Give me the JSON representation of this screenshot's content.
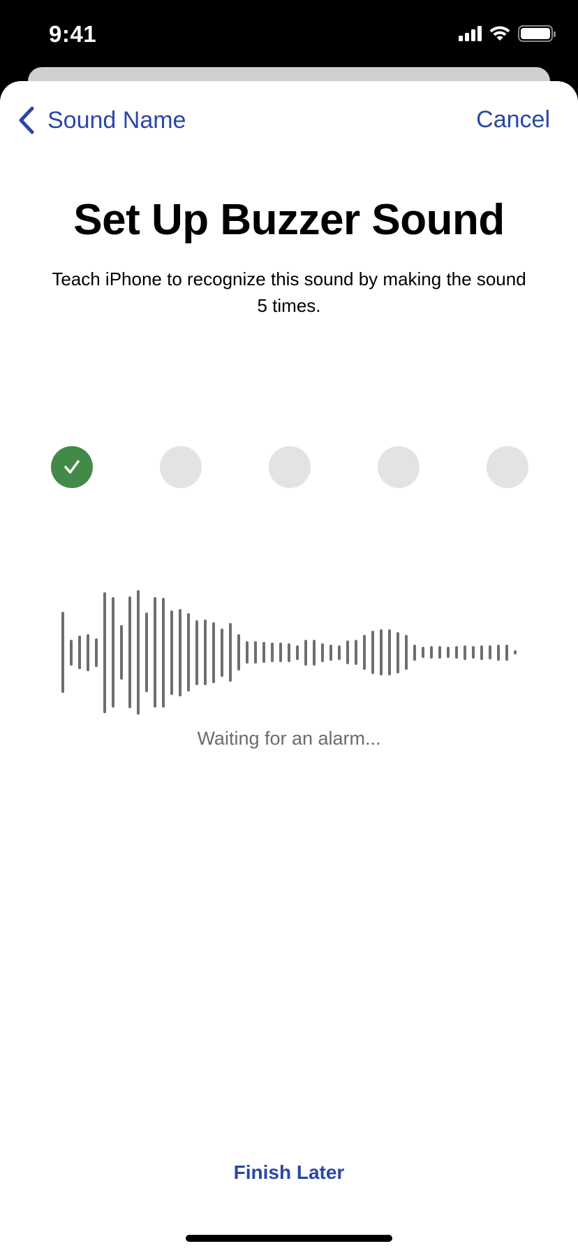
{
  "status_bar": {
    "time": "9:41",
    "icons": [
      "cellular-signal-icon",
      "wifi-icon",
      "battery-icon"
    ]
  },
  "nav": {
    "back_label": "Sound Name",
    "back_icon": "chevron-left-icon",
    "cancel_label": "Cancel"
  },
  "content": {
    "title": "Set Up Buzzer Sound",
    "subtitle": "Teach iPhone to recognize this sound by making the sound 5 times.",
    "caption": "Waiting for an alarm..."
  },
  "progress": {
    "total": 5,
    "completed": 1,
    "steps": [
      {
        "state": "done",
        "icon": "checkmark-icon"
      },
      {
        "state": "pending"
      },
      {
        "state": "pending"
      },
      {
        "state": "pending"
      },
      {
        "state": "pending"
      }
    ]
  },
  "waveform": {
    "amplitudes": [
      0.65,
      0.21,
      0.27,
      0.3,
      0.23,
      0.97,
      0.89,
      0.44,
      0.9,
      1.0,
      0.64,
      0.89,
      0.88,
      0.68,
      0.7,
      0.63,
      0.52,
      0.53,
      0.49,
      0.39,
      0.47,
      0.29,
      0.18,
      0.18,
      0.17,
      0.16,
      0.16,
      0.15,
      0.12,
      0.21,
      0.21,
      0.15,
      0.13,
      0.12,
      0.19,
      0.2,
      0.28,
      0.35,
      0.37,
      0.37,
      0.33,
      0.28,
      0.13,
      0.09,
      0.1,
      0.1,
      0.09,
      0.1,
      0.12,
      0.1,
      0.12,
      0.11,
      0.13,
      0.13,
      0.03
    ]
  },
  "footer": {
    "finish_later_label": "Finish Later"
  },
  "colors": {
    "accent": "#2a47a6",
    "success": "#438a48",
    "pending_dot": "#e3e3e5",
    "waveform": "#6e6e6e"
  }
}
